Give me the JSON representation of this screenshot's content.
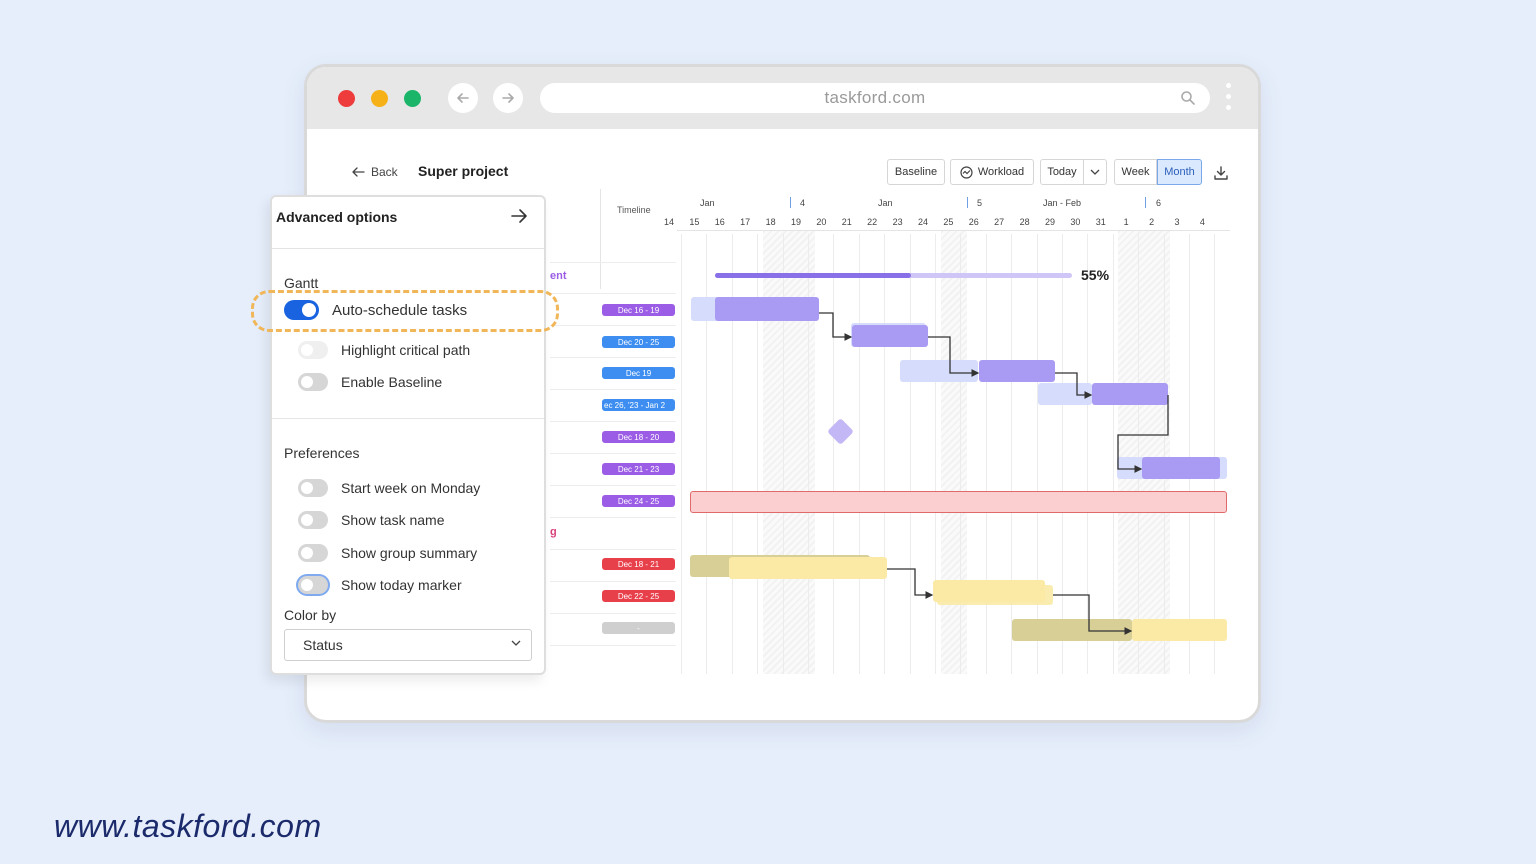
{
  "browser": {
    "url": "taskford.com"
  },
  "toolbar": {
    "back_label": "Back",
    "project_title": "Super project",
    "buttons": {
      "baseline": "Baseline",
      "workload": "Workload",
      "today": "Today",
      "week": "Week",
      "month": "Month"
    },
    "active_view": "Month"
  },
  "gantt": {
    "timeline_label": "Timeline",
    "months": [
      "Jan",
      "4",
      "Jan",
      "5",
      "Jan - Feb",
      "6"
    ],
    "days": [
      "14",
      "15",
      "16",
      "17",
      "18",
      "19",
      "20",
      "21",
      "22",
      "23",
      "24",
      "25",
      "26",
      "27",
      "28",
      "29",
      "30",
      "31",
      "1",
      "2",
      "3",
      "4"
    ],
    "progress_label": "55%",
    "progress": 0.55,
    "group_fragments": [
      "ent",
      "g"
    ],
    "date_pills": [
      "Dec 16 - 19",
      "Dec 20 - 25",
      "Dec 19",
      "ec 26, '23 - Jan 2",
      "Dec 18 - 20",
      "Dec 21 - 23",
      "Dec 24 - 25",
      "Dec 18 - 21",
      "Dec 22 - 25",
      "-"
    ],
    "colors": {
      "purple": "#9b5de5",
      "blue": "#3d8ef0",
      "red": "#e8404b",
      "gray": "#cfcfcf"
    }
  },
  "panel": {
    "title": "Advanced options",
    "gantt_section": "Gantt",
    "gantt_options": [
      "Auto-schedule tasks",
      "Highlight critical path",
      "Enable Baseline"
    ],
    "preferences_section": "Preferences",
    "preference_options": [
      "Start week on Monday",
      "Show task name",
      "Show group summary",
      "Show today marker"
    ],
    "color_by_label": "Color by",
    "color_by_value": "Status"
  },
  "footer": {
    "website": "www.taskford.com"
  }
}
